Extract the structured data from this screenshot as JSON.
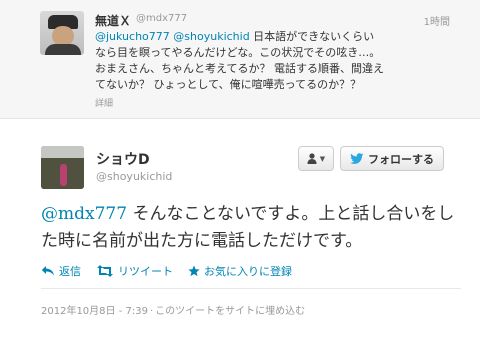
{
  "previous_tweet": {
    "name": "無道Ｘ",
    "handle": "@mdx777",
    "time": "1時間",
    "mention1": "@jukucho777",
    "mention2": "@shoyukichid",
    "text": " 日本語ができないくらいなら目を瞑ってやるんだけどな。この状況でその呟き…。おまえさん、ちゃんと考えてるか？ 電話する順番、間違えてないか？ ひょっとして、俺に喧嘩売ってるのか？？",
    "detail": "詳細"
  },
  "main_tweet": {
    "name": "ショウD",
    "handle": "@shoyukichid",
    "follow_label": "フォローする",
    "mention": "@mdx777",
    "text": " そんなことないですよ。上と話し合いをした時に名前が出た方に電話しただけです。",
    "actions": {
      "reply": "返信",
      "retweet": "リツイート",
      "favorite": "お気に入りに登録"
    },
    "timestamp": "2012年10月8日 - 7:39",
    "embed_link": "このツイートをサイトに埋め込む"
  },
  "colors": {
    "link": "#0084b4",
    "muted": "#999999",
    "text": "#333333",
    "twitter_blue": "#2aa9e0"
  }
}
